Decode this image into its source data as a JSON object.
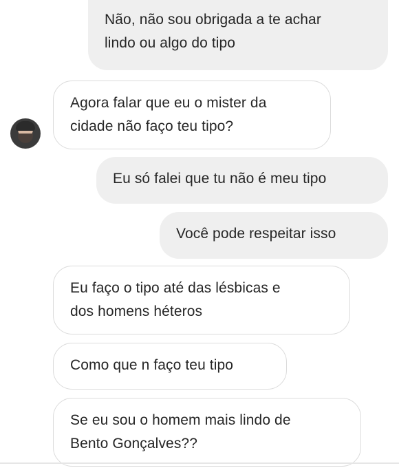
{
  "conversation": {
    "messages": [
      {
        "sender": "me",
        "text": "Não, não sou obrigada a te achar\nlindo ou algo do tipo"
      },
      {
        "sender": "other",
        "text": "Agora falar que eu o mister da\ncidade  não faço teu tipo?"
      },
      {
        "sender": "me",
        "text": "Eu só falei que tu não é meu tipo"
      },
      {
        "sender": "me",
        "text": "Você pode respeitar isso"
      },
      {
        "sender": "other",
        "text": "Eu faço o tipo até das lésbicas e\ndos homens héteros"
      },
      {
        "sender": "other",
        "text": "Como que n faço teu tipo"
      },
      {
        "sender": "other",
        "text": "Se eu sou o homem mais lindo de\nBento Gonçalves??"
      }
    ]
  }
}
